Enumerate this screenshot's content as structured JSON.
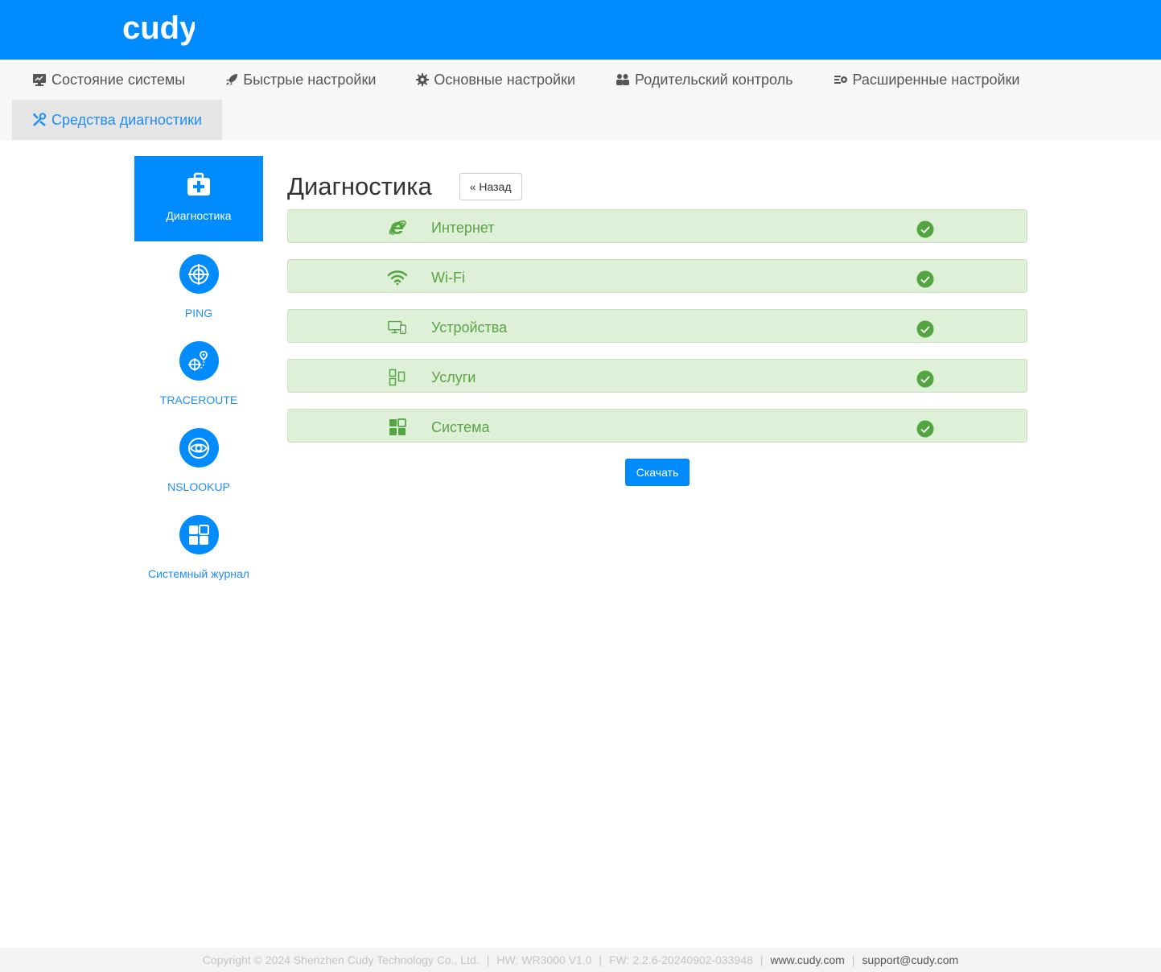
{
  "brand": {
    "logo": "cudy",
    "accent": "#008bff"
  },
  "nav": {
    "items": [
      {
        "label": "Состояние системы",
        "icon": "monitor-icon"
      },
      {
        "label": "Быстрые настройки",
        "icon": "rocket-icon"
      },
      {
        "label": "Основные настройки",
        "icon": "gear-icon"
      },
      {
        "label": "Родительский контроль",
        "icon": "users-icon"
      },
      {
        "label": "Расширенные настройки",
        "icon": "advanced-settings-icon"
      },
      {
        "label": "Средства диагностики",
        "icon": "tools-icon",
        "active": true
      }
    ]
  },
  "sidebar": {
    "items": [
      {
        "label": "Диагностика",
        "icon": "medkit-icon",
        "active": true
      },
      {
        "label": "PING",
        "icon": "target-icon"
      },
      {
        "label": "TRACEROUTE",
        "icon": "route-icon"
      },
      {
        "label": "NSLOOKUP",
        "icon": "eye-icon"
      },
      {
        "label": "Системный журнал",
        "icon": "grid-icon"
      }
    ]
  },
  "main": {
    "title": "Диагностика",
    "back_label": "« Назад",
    "checks": [
      {
        "label": "Интернет",
        "icon": "internet-explorer-icon",
        "status": "ok"
      },
      {
        "label": "Wi-Fi",
        "icon": "wifi-icon",
        "status": "ok"
      },
      {
        "label": "Устройства",
        "icon": "devices-icon",
        "status": "ok"
      },
      {
        "label": "Услуги",
        "icon": "services-icon",
        "status": "ok"
      },
      {
        "label": "Система",
        "icon": "system-grid-icon",
        "status": "ok"
      }
    ],
    "download_label": "Скачать",
    "ok_color": "#52a540"
  },
  "footer": {
    "copyright": "Copyright © 2024 Shenzhen Cudy Technology Co., Ltd.",
    "hw": "HW: WR3000 V1.0",
    "fw": "FW: 2.2.6-20240902-033948",
    "website": "www.cudy.com",
    "email": "support@cudy.com"
  }
}
